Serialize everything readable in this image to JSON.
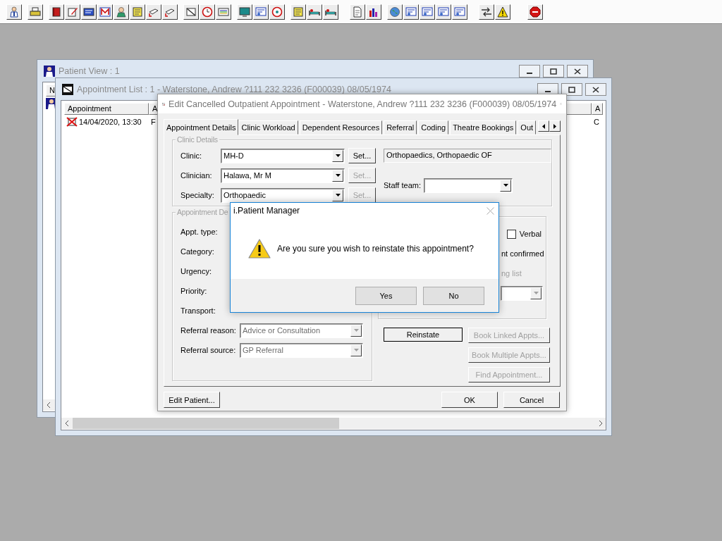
{
  "patient_view": {
    "title": "Patient View : 1",
    "column_1": "N"
  },
  "appointment_list": {
    "title": "Appointment List : 1 - Waterstone, Andrew ?111 232 3236 (F000039) 08/05/1974",
    "columns": [
      "Appointment",
      "A",
      "A"
    ],
    "rows": [
      {
        "cells": [
          "14/04/2020, 13:30",
          "F",
          "C"
        ]
      }
    ]
  },
  "edit_dialog": {
    "title": "Edit Cancelled Outpatient Appointment - Waterstone, Andrew ?111 232 3236 (F000039) 08/05/1974",
    "tabs": [
      {
        "label": "Appointment Details",
        "selected": true
      },
      {
        "label": "Clinic Workload",
        "selected": false
      },
      {
        "label": "Dependent Resources",
        "selected": false
      },
      {
        "label": "Referral",
        "selected": false
      },
      {
        "label": "Coding",
        "selected": false
      },
      {
        "label": "Theatre Bookings",
        "selected": false
      },
      {
        "label": "Out",
        "selected": false
      }
    ],
    "clinic_details": {
      "legend": "Clinic Details",
      "fields": [
        {
          "label": "Clinic:",
          "value": "MH-D",
          "set_button": {
            "label": "Set...",
            "disabled": false
          }
        },
        {
          "label": "Clinician:",
          "value": "Halawa, Mr M",
          "set_button": {
            "label": "Set...",
            "disabled": true
          }
        },
        {
          "label": "Specialty:",
          "value": "Orthopaedic",
          "set_button": {
            "label": "Set...",
            "disabled": true
          }
        }
      ],
      "clinic_name": "Orthopaedics, Orthopaedic OF",
      "staff_team": {
        "label": "Staff team:",
        "disabled": false
      }
    },
    "appointment_details": {
      "legend": "Appointment De",
      "fields": [
        {
          "label": "Appt. type:"
        },
        {
          "label": "Category:"
        },
        {
          "label": "Urgency:"
        },
        {
          "label": "Priority:"
        },
        {
          "label": "Transport:"
        },
        {
          "label": "Referral reason:",
          "value": "Advice or Consultation",
          "disabled": true
        },
        {
          "label": "Referral source:",
          "value": "GP Referral",
          "disabled": true
        }
      ]
    },
    "options": {
      "verbal": {
        "label": "Verbal",
        "checked": false
      },
      "confirmed": {
        "text": "nt confirmed",
        "disabled": false
      },
      "waiting": {
        "text": "ng list",
        "disabled": true
      },
      "dropdown": {
        "disabled": true
      }
    },
    "actions": [
      {
        "label": "Reinstate",
        "disabled": false
      },
      {
        "label": "Book Linked Appts...",
        "disabled": true
      },
      {
        "label": "Book Multiple Appts...",
        "disabled": true
      },
      {
        "label": "Find Appointment...",
        "disabled": true
      }
    ],
    "footer": {
      "left": "Edit Patient...",
      "right": [
        "OK",
        "Cancel"
      ]
    }
  },
  "message_box": {
    "title": "i.Patient Manager",
    "message": "Are you sure you wish to reinstate this appointment?",
    "buttons": [
      "Yes",
      "No"
    ]
  }
}
